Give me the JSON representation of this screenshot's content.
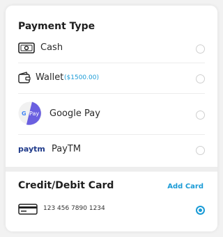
{
  "payment_type": {
    "title": "Payment Type",
    "options": [
      {
        "label": "Cash",
        "icon": "cash-icon"
      },
      {
        "label": "Wallet",
        "balance": "($1500.00)",
        "icon": "wallet-icon"
      },
      {
        "label": "Google Pay",
        "icon": "google-pay-icon",
        "icon_text": "Pay"
      },
      {
        "label": "PayTM",
        "icon": "paytm-logo",
        "logo_text": "paytm"
      }
    ]
  },
  "credit_debit": {
    "title": "Credit/Debit Card",
    "add_card_label": "Add Card",
    "card_number": "123 456 7890 1234",
    "icon": "credit-card-icon",
    "selected": true
  },
  "colors": {
    "accent": "#1a9bd6",
    "google_pay_purple": "#6a5fe0",
    "paytm_navy": "#1f3a8a",
    "paytm_blue": "#1ba6e3"
  }
}
